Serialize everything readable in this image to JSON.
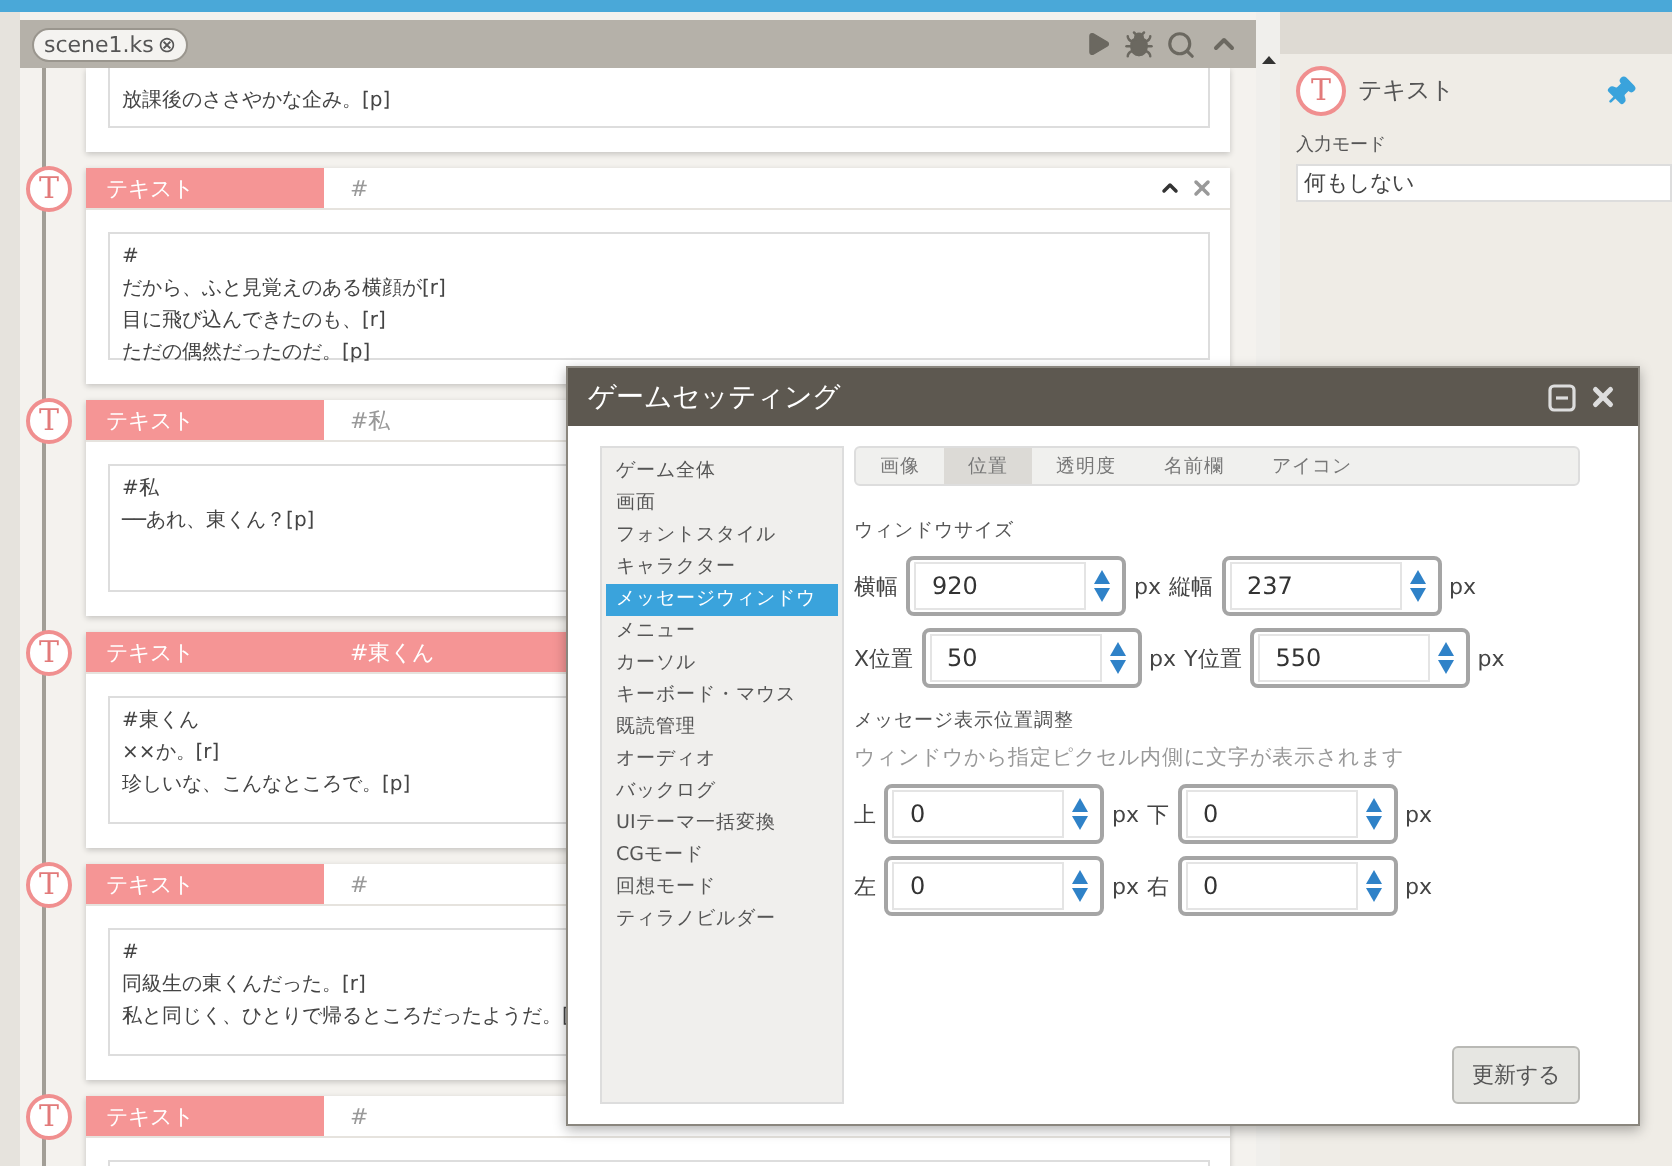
{
  "editor": {
    "tab": {
      "label": "scene1.ks",
      "close": "⊗"
    },
    "blocks": [
      {
        "lines": [
          "放課後のささやかな企み。[p]"
        ]
      },
      {
        "marker": "T",
        "label": "テキスト",
        "speaker": "#",
        "selected": false,
        "controls": true,
        "lines": [
          "#",
          "だから、ふと見覚えのある横顔が[r]",
          "目に飛び込んできたのも、[r]",
          "ただの偶然だったのだ。[p]"
        ]
      },
      {
        "marker": "T",
        "label": "テキスト",
        "speaker": "#私",
        "selected": false,
        "lines": [
          "#私",
          "──あれ、東くん？[p]"
        ]
      },
      {
        "marker": "T",
        "label": "テキスト",
        "speaker": "#東くん",
        "selected": true,
        "lines": [
          "#東くん",
          "××か。[r]",
          "珍しいな、こんなところで。[p]"
        ]
      },
      {
        "marker": "T",
        "label": "テキスト",
        "speaker": "#",
        "selected": false,
        "lines": [
          "#",
          "同級生の東くんだった。[r]",
          "私と同じく、ひとりで帰るところだったようだ。["
        ]
      },
      {
        "marker": "T",
        "label": "テキスト",
        "speaker": "#",
        "selected": false
      }
    ]
  },
  "inspector": {
    "marker": "T",
    "title": "テキスト",
    "field_label": "入力モード",
    "field_value": "何もしない"
  },
  "dialog": {
    "title": "ゲームセッティング",
    "menu": [
      {
        "label": "ゲーム全体",
        "selected": false
      },
      {
        "label": "画面",
        "selected": false
      },
      {
        "label": "フォントスタイル",
        "selected": false
      },
      {
        "label": "キャラクター",
        "selected": false
      },
      {
        "label": "メッセージウィンドウ",
        "selected": true
      },
      {
        "label": "メニュー",
        "selected": false
      },
      {
        "label": "カーソル",
        "selected": false
      },
      {
        "label": "キーボード・マウス",
        "selected": false
      },
      {
        "label": "既読管理",
        "selected": false
      },
      {
        "label": "オーディオ",
        "selected": false
      },
      {
        "label": "バックログ",
        "selected": false
      },
      {
        "label": "UIテーマ一括変換",
        "selected": false
      },
      {
        "label": "CGモード",
        "selected": false
      },
      {
        "label": "回想モード",
        "selected": false
      },
      {
        "label": "ティラノビルダー",
        "selected": false
      }
    ],
    "tabs": [
      {
        "label": "画像",
        "selected": false
      },
      {
        "label": "位置",
        "selected": true
      },
      {
        "label": "透明度",
        "selected": false
      },
      {
        "label": "名前欄",
        "selected": false
      },
      {
        "label": "アイコン",
        "selected": false
      }
    ],
    "sections": [
      {
        "heading": "ウィンドウサイズ",
        "rows": [
          [
            {
              "label": "横幅",
              "value": "920",
              "unit": "px"
            },
            {
              "label": "縦幅",
              "value": "237",
              "unit": "px"
            }
          ],
          [
            {
              "label": "X位置",
              "value": "50",
              "unit": "px"
            },
            {
              "label": "Y位置",
              "value": "550",
              "unit": "px"
            }
          ]
        ]
      },
      {
        "heading": "メッセージ表示位置調整",
        "note": "ウィンドウから指定ピクセル内側に文字が表示されます",
        "rows": [
          [
            {
              "label": "上",
              "value": "0",
              "unit": "px"
            },
            {
              "label": "下",
              "value": "0",
              "unit": "px"
            }
          ],
          [
            {
              "label": "左",
              "value": "0",
              "unit": "px"
            },
            {
              "label": "右",
              "value": "0",
              "unit": "px"
            }
          ]
        ]
      }
    ],
    "button": "更新する"
  }
}
